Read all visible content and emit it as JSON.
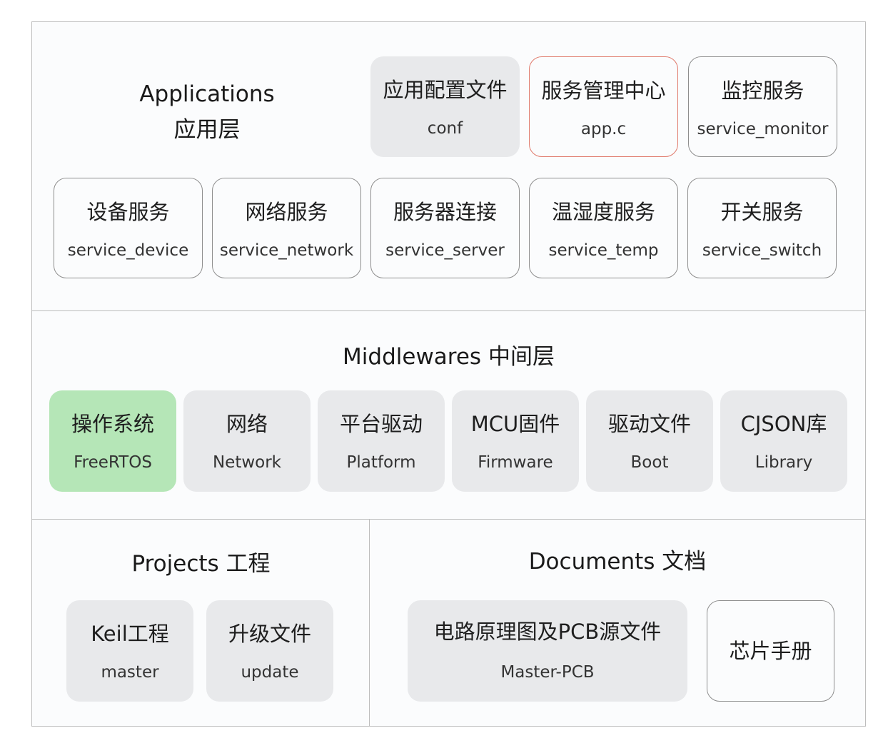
{
  "diagram": {
    "applications": {
      "title_en": "Applications",
      "title_zh": "应用层",
      "boxes": [
        {
          "zh": "应用配置文件",
          "en": "conf",
          "style": "gray"
        },
        {
          "zh": "服务管理中心",
          "en": "app.c",
          "style": "red-outline"
        },
        {
          "zh": "监控服务",
          "en": "service_monitor",
          "style": "outline"
        },
        {
          "zh": "设备服务",
          "en": "service_device",
          "style": "outline"
        },
        {
          "zh": "网络服务",
          "en": "service_network",
          "style": "outline"
        },
        {
          "zh": "服务器连接",
          "en": "service_server",
          "style": "outline"
        },
        {
          "zh": "温湿度服务",
          "en": "service_temp",
          "style": "outline"
        },
        {
          "zh": "开关服务",
          "en": "service_switch",
          "style": "outline"
        }
      ]
    },
    "middlewares": {
      "title": "Middlewares 中间层",
      "boxes": [
        {
          "zh": "操作系统",
          "en": "FreeRTOS",
          "style": "green"
        },
        {
          "zh": "网络",
          "en": "Network",
          "style": "gray"
        },
        {
          "zh": "平台驱动",
          "en": "Platform",
          "style": "gray"
        },
        {
          "zh": "MCU固件",
          "en": "Firmware",
          "style": "gray"
        },
        {
          "zh": "驱动文件",
          "en": "Boot",
          "style": "gray"
        },
        {
          "zh": "CJSON库",
          "en": "Library",
          "style": "gray"
        }
      ]
    },
    "projects": {
      "title": "Projects 工程",
      "boxes": [
        {
          "zh": "Keil工程",
          "en": "master",
          "style": "gray"
        },
        {
          "zh": "升级文件",
          "en": "update",
          "style": "gray"
        }
      ]
    },
    "documents": {
      "title": "Documents 文档",
      "boxes": [
        {
          "zh": "电路原理图及PCB源文件",
          "en": "Master-PCB",
          "style": "gray"
        },
        {
          "zh": "芯片手册",
          "style": "outline"
        }
      ]
    },
    "colors": {
      "border": "#bdbdbd",
      "gray_box": "#e8e9eb",
      "green_box": "#b5e6b7",
      "red_outline": "#e07a6c",
      "outline": "#8e8e8e"
    }
  }
}
